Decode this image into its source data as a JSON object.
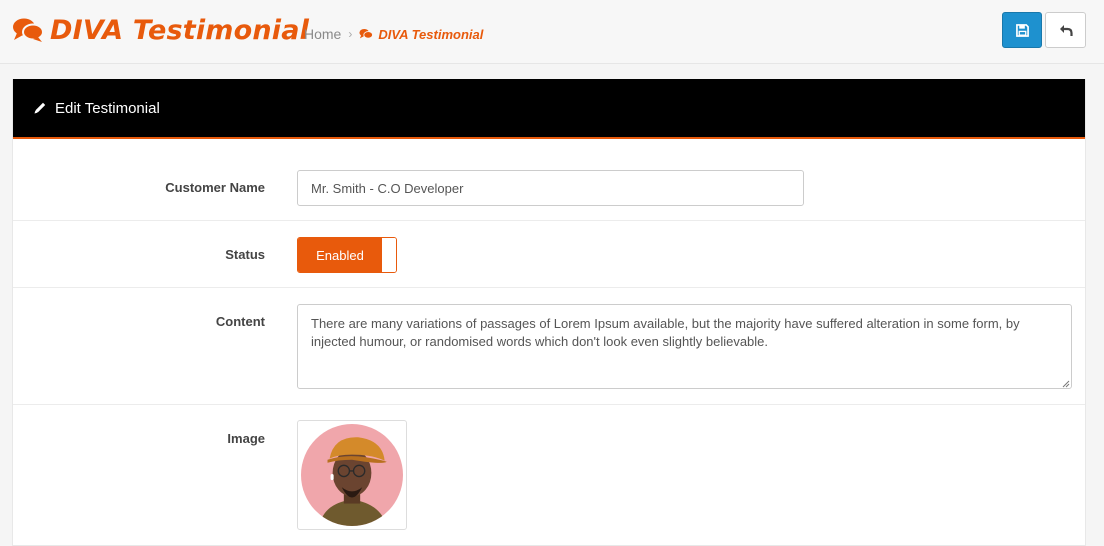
{
  "header": {
    "title": "DIVA Testimonial",
    "title_icon": "comments-icon",
    "breadcrumb": [
      {
        "label": "Home"
      },
      {
        "label": "DIVA Testimonial",
        "icon": "comments-icon"
      }
    ],
    "buttons": [
      {
        "name": "save-button",
        "icon": "save-icon"
      },
      {
        "name": "back-button",
        "icon": "reply-icon"
      }
    ]
  },
  "panel": {
    "heading": "Edit Testimonial",
    "heading_icon": "pencil-icon"
  },
  "form": {
    "customer_name": {
      "label": "Customer Name",
      "value": "Mr. Smith - C.O Developer"
    },
    "status": {
      "label": "Status",
      "value": "Enabled"
    },
    "content": {
      "label": "Content",
      "value": "There are many variations of passages of Lorem Ipsum available, but the majority have suffered alteration in some form, by injected humour, or randomised words which don't look even slightly believable."
    },
    "image": {
      "label": "Image"
    }
  },
  "colors": {
    "accent": "#e85a0c",
    "primary_button": "#1e91cf",
    "panel_heading_bg": "#000000"
  }
}
